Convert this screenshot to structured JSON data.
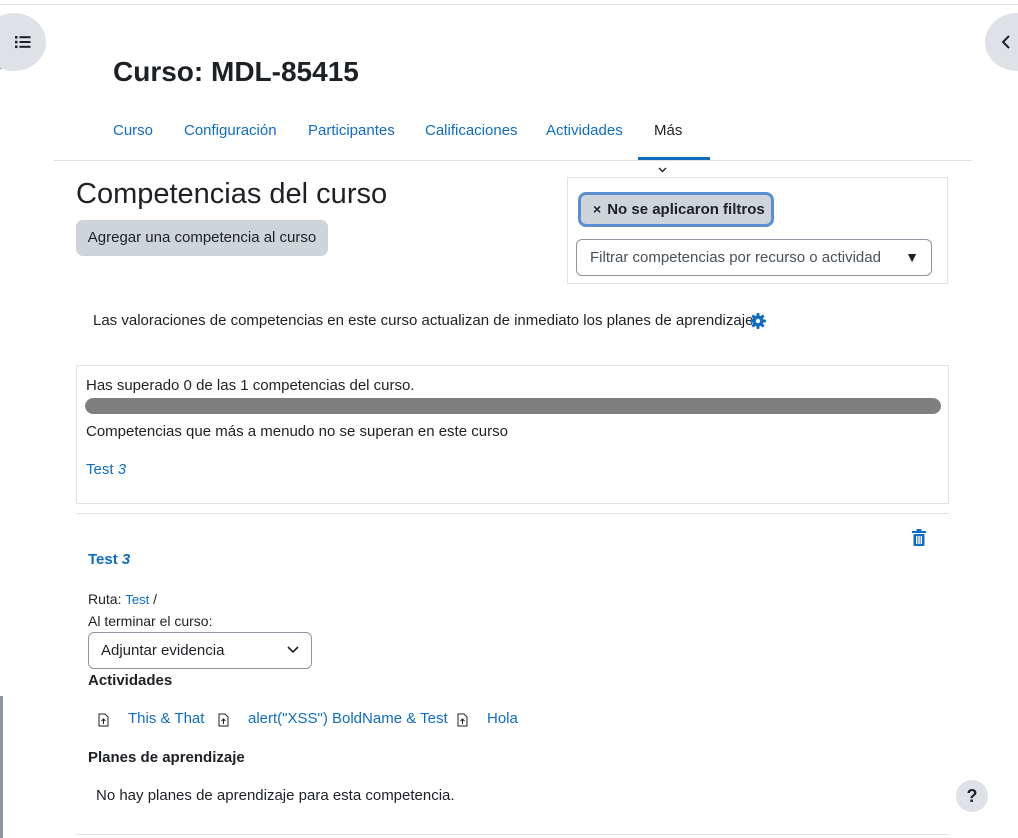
{
  "course": {
    "title": "Curso: MDL-85415"
  },
  "nav": {
    "tabs": [
      {
        "label": "Curso"
      },
      {
        "label": "Configuración"
      },
      {
        "label": "Participantes"
      },
      {
        "label": "Calificaciones"
      },
      {
        "label": "Actividades"
      },
      {
        "label": "Más"
      }
    ],
    "active_tab": "Más"
  },
  "page": {
    "heading": "Competencias del curso",
    "add_button": "Agregar una competencia al curso",
    "info": "Las valoraciones de competencias en este curso actualizan de inmediato los planes de aprendizaje."
  },
  "filter": {
    "chip_close": "×",
    "chip_label": "No se aplicaron filtros",
    "placeholder": "Filtrar competencias por recurso o actividad",
    "dropdown_glyph": "▼"
  },
  "stats": {
    "achieved_text": "Has superado 0 de las 1 competencias del curso.",
    "progress_fraction": 0.0,
    "most_failed_text": "Competencias que más a menudo no se superan en este curso",
    "most_failed_link_name": "Test",
    "most_failed_link_num": "3"
  },
  "competency": {
    "name": "Test",
    "number": "3",
    "path_label": "Ruta:",
    "path_link": "Test",
    "path_sep": "/",
    "completion_label": "Al terminar el curso:",
    "completion_value": "Adjuntar evidencia",
    "activities_heading": "Actividades",
    "activities": [
      {
        "label": "This & That"
      },
      {
        "label": "alert(\"XSS\") BoldName & Test"
      },
      {
        "label": "Hola"
      }
    ],
    "plans_heading": "Planes de aprendizaje",
    "no_plans": "No hay planes de aprendizaje para esta competencia."
  },
  "help": {
    "label": "?"
  },
  "icons": {
    "left_drawer": "list-icon",
    "right_drawer": "chevron-left-icon",
    "settings": "gear-icon",
    "delete": "trash-icon",
    "activity": "file-icon"
  },
  "colors": {
    "link": "#0f6cbf",
    "text": "#1d2125",
    "button_bg": "#ced4da",
    "progress_fill": "#7f7f7f"
  }
}
